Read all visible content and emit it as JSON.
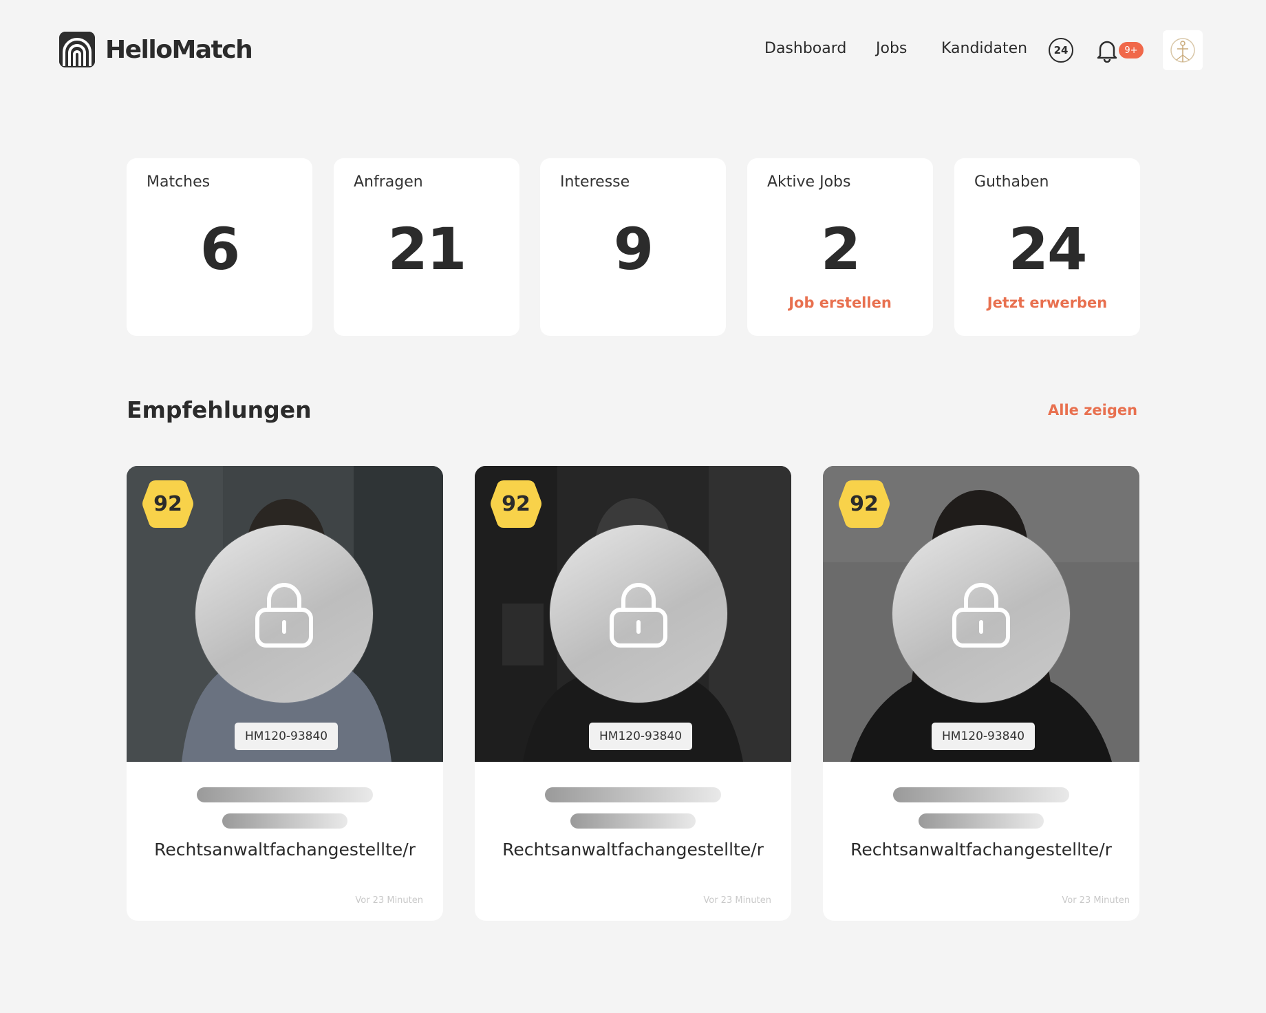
{
  "app": {
    "name": "HelloMatch"
  },
  "nav": {
    "items": [
      {
        "label": "Dashboard"
      },
      {
        "label": "Jobs"
      },
      {
        "label": "Kandidaten"
      }
    ],
    "credit_badge": "24",
    "notifications_count": "9+"
  },
  "stats": [
    {
      "label": "Matches",
      "value": "6"
    },
    {
      "label": "Anfragen",
      "value": "21"
    },
    {
      "label": "Interesse",
      "value": "9"
    },
    {
      "label": "Aktive Jobs",
      "value": "2",
      "action": "Job erstellen"
    },
    {
      "label": "Guthaben",
      "value": "24",
      "action": "Jetzt erwerben"
    }
  ],
  "recommendations": {
    "title": "Empfehlungen",
    "show_all": "Alle zeigen",
    "cards": [
      {
        "score": "92",
        "id": "HM120-93840",
        "title": "Rechtsanwaltfachangestellte/r",
        "time": "Vor 23 Minuten"
      },
      {
        "score": "92",
        "id": "HM120-93840",
        "title": "Rechtsanwaltfachangestellte/r",
        "time": "Vor 23 Minuten"
      },
      {
        "score": "92",
        "id": "HM120-93840",
        "title": "Rechtsanwaltfachangestellte/r",
        "time": "Vor 23 Minuten"
      }
    ]
  },
  "colors": {
    "accent": "#e8704f",
    "badge_yellow": "#f8d24a",
    "notification_red": "#f0684a",
    "background": "#f4f4f4"
  },
  "icons": {
    "logo": "hellomatch-arch-icon",
    "credits": "credits-icon",
    "notifications": "bell-icon",
    "avatar": "company-logo-icon",
    "locked": "lock-icon"
  }
}
